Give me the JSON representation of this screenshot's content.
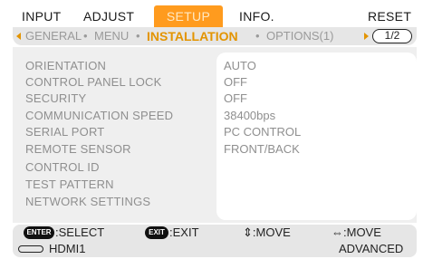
{
  "tabs": {
    "input": "INPUT",
    "adjust": "ADJUST",
    "setup": "SETUP",
    "info": "INFO.",
    "reset": "RESET"
  },
  "subtabs": {
    "general": "GENERAL",
    "menu": "MENU",
    "installation": "INSTALLATION",
    "options": "OPTIONS(1)",
    "page": "1/2",
    "separator": "•"
  },
  "rows": [
    {
      "label": "ORIENTATION",
      "value": "AUTO"
    },
    {
      "label": "CONTROL PANEL LOCK",
      "value": "OFF"
    },
    {
      "label": "SECURITY",
      "value": "OFF"
    },
    {
      "label": "COMMUNICATION SPEED",
      "value": "38400bps"
    },
    {
      "label": "SERIAL PORT",
      "value": "PC CONTROL"
    },
    {
      "label": "REMOTE SENSOR",
      "value": "FRONT/BACK"
    },
    {
      "label": "CONTROL ID",
      "value": ""
    },
    {
      "label": "TEST PATTERN",
      "value": ""
    },
    {
      "label": "NETWORK SETTINGS",
      "value": ""
    }
  ],
  "footer": {
    "enter_key": "ENTER",
    "select": ":SELECT",
    "exit_key": "EXIT",
    "exit": ":EXIT",
    "move_v": "⇕:MOVE",
    "move_h": "⇔:MOVE"
  },
  "status": {
    "source": "HDMI1",
    "mode": "ADVANCED"
  },
  "colors": {
    "accent": "#ff9b1e",
    "active_sub": "#e39400",
    "panel": "#efefef"
  },
  "icons": {
    "left_arrow": "left-arrow-icon",
    "right_arrow": "right-arrow-icon",
    "hdmi": "hdmi-connector-icon"
  }
}
